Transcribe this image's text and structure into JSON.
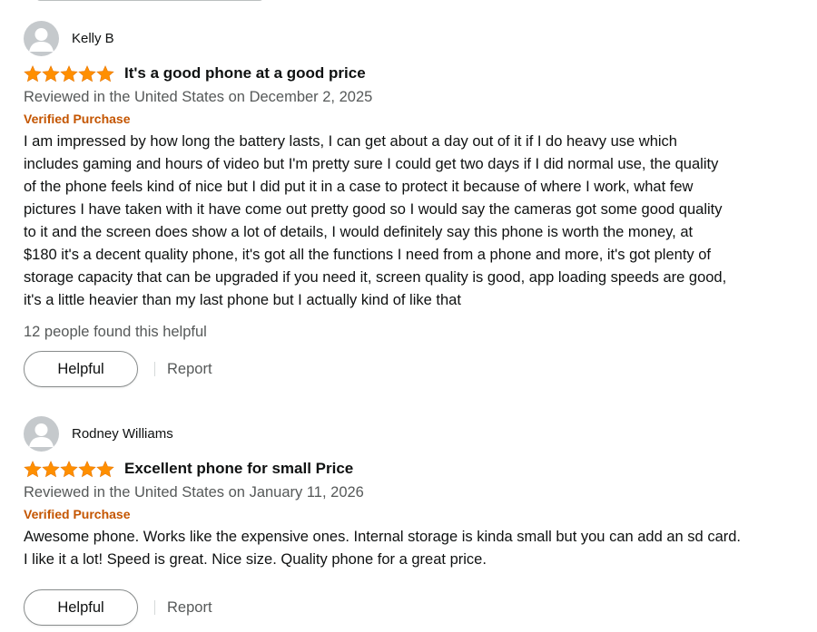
{
  "reviews": [
    {
      "author": "Kelly B",
      "rating": 5,
      "max_rating": 5,
      "title": "It's a good phone at a good price",
      "date": "Reviewed in the United States on December 2, 2025",
      "verified": "Verified Purchase",
      "body_lines": [
        "I am impressed by how long the battery lasts, I can get about a day out of it if I do heavy use which",
        "includes gaming and hours of video but I'm pretty sure I could get two days if I did normal use, the quality",
        "of the phone feels kind of nice but I did put it in a case to protect it because of where I work, what few",
        "pictures I have taken with it have come out pretty good so I would say the cameras got some good quality",
        "to it and the screen does show a lot of details, I would definitely say this phone is worth the money, at",
        "$180 it's a decent quality phone, it's got all the functions I need from a phone and more, it's got plenty of",
        "storage capacity that can be upgraded if you need it, screen quality is good, app loading speeds are good,",
        "it's a little heavier than my last phone but I actually kind of like that"
      ],
      "helpful_count": "12 people found this helpful",
      "helpful_label": "Helpful",
      "report_label": "Report"
    },
    {
      "author": "Rodney Williams",
      "rating": 5,
      "max_rating": 5,
      "title": "Excellent phone for small Price",
      "date": "Reviewed in the United States on January 11, 2026",
      "verified": "Verified Purchase",
      "body_lines": [
        "Awesome phone. Works like the expensive ones. Internal storage is kinda small but you can add an sd card.",
        "I like it a lot! Speed is great. Nice size. Quality phone for a great price."
      ],
      "helpful_label": "Helpful",
      "report_label": "Report"
    }
  ],
  "icons": {
    "avatar": "default-avatar-icon",
    "star": "star-icon"
  },
  "colors": {
    "star": "#ff8f00",
    "verified": "#c45500",
    "secondary_text": "#565959",
    "primary_text": "#0f1111"
  }
}
